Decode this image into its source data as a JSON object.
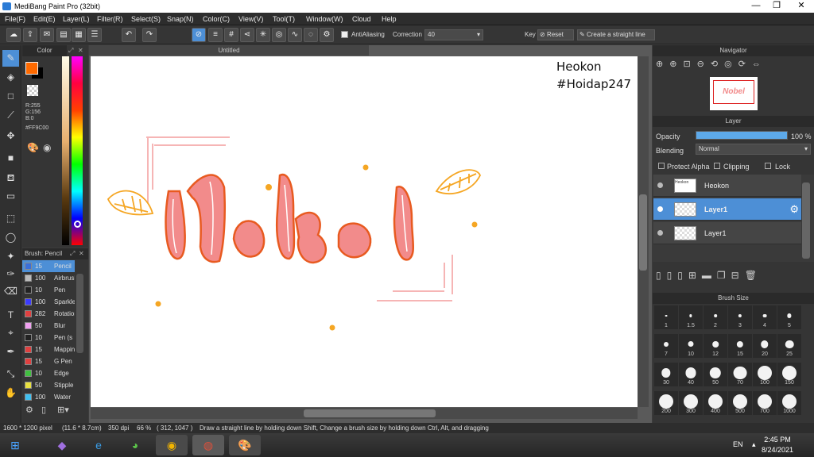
{
  "app": {
    "title": "MediBang Paint Pro (32bit)"
  },
  "menu": [
    "File(F)",
    "Edit(E)",
    "Layer(L)",
    "Filter(R)",
    "Select(S)",
    "Snap(N)",
    "Color(C)",
    "View(V)",
    "Tool(T)",
    "Window(W)",
    "Cloud",
    "Help"
  ],
  "toolbar": {
    "antialiasing_label": "AntiAliasing",
    "correction_label": "Correction",
    "correction_value": "40",
    "key_label": "Key",
    "reset_label": "Reset",
    "straight_line_label": "Create a straight line"
  },
  "color_panel": {
    "title": "Color",
    "r": "R:255",
    "g": "G:156",
    "b": "B:0",
    "hex": "#FF9C00",
    "primary": "#FF6A00"
  },
  "brush_panel": {
    "title": "Brush: Pencil",
    "items": [
      {
        "size": "15",
        "label": "Pencil",
        "color": "#3a6fd8"
      },
      {
        "size": "100",
        "label": "Airbrush",
        "color": "#bbbbbb"
      },
      {
        "size": "10",
        "label": "Pen",
        "color": "#222222"
      },
      {
        "size": "100",
        "label": "Sparkle",
        "color": "#3b3bff"
      },
      {
        "size": "282",
        "label": "Rotation",
        "color": "#e04040"
      },
      {
        "size": "50",
        "label": "Blur",
        "color": "#f0a0f0"
      },
      {
        "size": "10",
        "label": "Pen (s",
        "color": "#222222"
      },
      {
        "size": "15",
        "label": "Mapping",
        "color": "#e04040"
      },
      {
        "size": "15",
        "label": "G Pen",
        "color": "#e04040"
      },
      {
        "size": "10",
        "label": "Edge",
        "color": "#40c040"
      },
      {
        "size": "50",
        "label": "Stipple",
        "color": "#e8e040"
      },
      {
        "size": "100",
        "label": "Water",
        "color": "#40c0f0"
      }
    ]
  },
  "document": {
    "tab": "Untitled",
    "watermark_line1": "Heokon",
    "watermark_line2": "#Hoidap247",
    "artwork_text": "Nobel"
  },
  "navigator": {
    "title": "Navigator",
    "thumb_text": "Nobel"
  },
  "layer_panel": {
    "title": "Layer",
    "opacity_label": "Opacity",
    "opacity_value": "100 %",
    "opacity_level": 1.0,
    "blending_label": "Blending",
    "blending_value": "Normal",
    "protect_alpha": "Protect Alpha",
    "clipping": "Clipping",
    "lock": "Lock",
    "layers": [
      {
        "name": "Heokon",
        "thumb": "Heokon"
      },
      {
        "name": "Layer1",
        "thumb": ""
      },
      {
        "name": "Layer1",
        "thumb": ""
      }
    ]
  },
  "brush_size": {
    "title": "Brush Size",
    "sizes": [
      "1",
      "1.5",
      "2",
      "3",
      "4",
      "5",
      "7",
      "10",
      "12",
      "15",
      "20",
      "25",
      "30",
      "40",
      "50",
      "70",
      "100",
      "150",
      "200",
      "300",
      "400",
      "500",
      "700",
      "1000"
    ]
  },
  "status": {
    "size": "1600 * 1200 pixel",
    "cm": "(11.6 * 8.7cm)",
    "dpi": "350 dpi",
    "zoom": "66 %",
    "coords": "( 312, 1047 )",
    "hint": "Draw a straight line by holding down Shift, Change a brush size by holding down Ctrl, Alt, and dragging"
  },
  "taskbar": {
    "lang": "EN",
    "time": "2:45 PM",
    "date": "8/24/2021"
  },
  "colors": {
    "accent": "#4d8fd6",
    "text_fill": "#f28b8b",
    "text_stroke": "#e85a20",
    "leaf": "#f5a623"
  }
}
